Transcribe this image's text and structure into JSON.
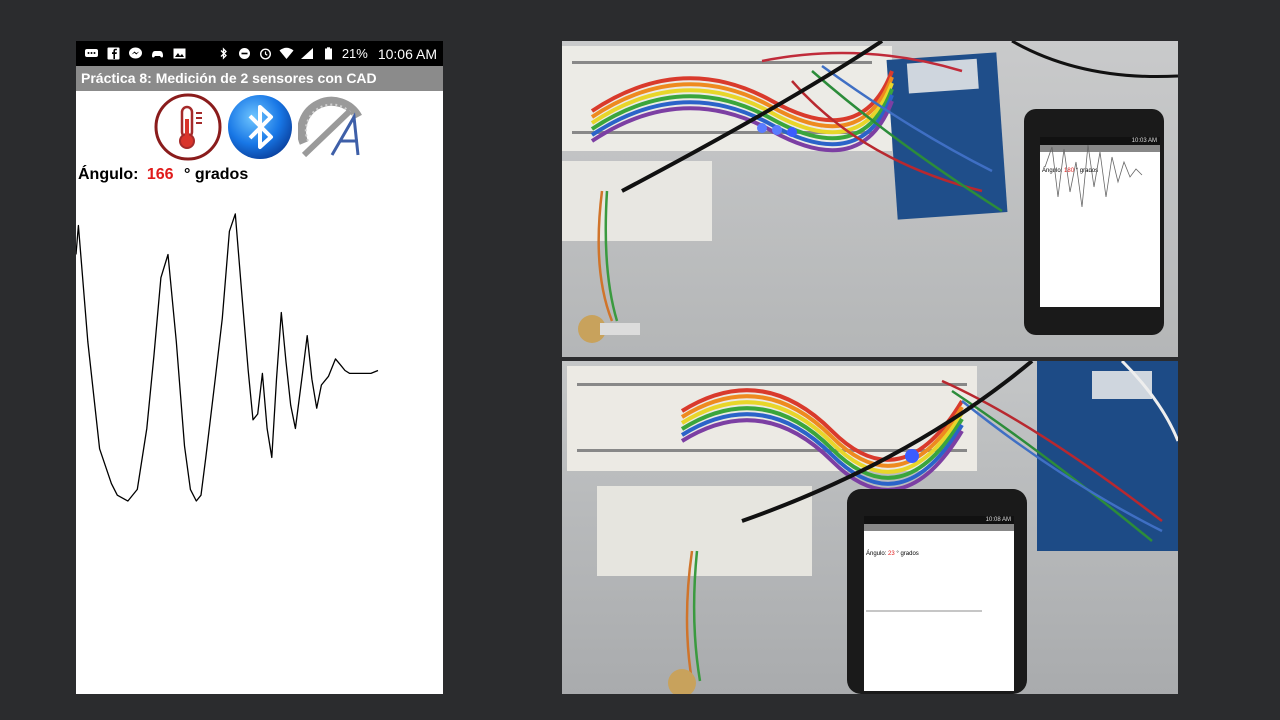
{
  "status_bar": {
    "battery": "21%",
    "time": "10:06 AM",
    "left_icons": [
      "chat-icon",
      "facebook-icon",
      "messenger-icon",
      "gamepad-icon",
      "photo-icon"
    ],
    "right_icons": [
      "bluetooth-icon",
      "dnd-icon",
      "alarm-icon",
      "wifi-icon",
      "signal-icon",
      "battery-icon"
    ]
  },
  "app": {
    "title": "Práctica 8: Medición de 2 sensores con CAD",
    "icons": [
      "thermometer-icon",
      "bluetooth-icon",
      "protractor-icon"
    ],
    "angle_label": "Ángulo:",
    "angle_value": "166",
    "angle_unit": "° grados"
  },
  "chart_data": {
    "type": "line",
    "title": "",
    "xlabel": "",
    "ylabel": "",
    "grid": false,
    "points": [
      [
        0,
        0.85
      ],
      [
        2,
        0.95
      ],
      [
        10,
        0.55
      ],
      [
        20,
        0.18
      ],
      [
        30,
        0.06
      ],
      [
        35,
        0.02
      ],
      [
        44,
        0.0
      ],
      [
        52,
        0.04
      ],
      [
        60,
        0.25
      ],
      [
        66,
        0.5
      ],
      [
        72,
        0.77
      ],
      [
        78,
        0.85
      ],
      [
        85,
        0.55
      ],
      [
        92,
        0.19
      ],
      [
        97,
        0.04
      ],
      [
        102,
        0.0
      ],
      [
        106,
        0.02
      ],
      [
        110,
        0.15
      ],
      [
        118,
        0.42
      ],
      [
        124,
        0.63
      ],
      [
        130,
        0.93
      ],
      [
        135,
        0.99
      ],
      [
        140,
        0.74
      ],
      [
        146,
        0.45
      ],
      [
        150,
        0.28
      ],
      [
        154,
        0.3
      ],
      [
        158,
        0.44
      ],
      [
        162,
        0.25
      ],
      [
        166,
        0.15
      ],
      [
        170,
        0.42
      ],
      [
        174,
        0.65
      ],
      [
        178,
        0.48
      ],
      [
        182,
        0.33
      ],
      [
        186,
        0.25
      ],
      [
        192,
        0.44
      ],
      [
        196,
        0.57
      ],
      [
        200,
        0.42
      ],
      [
        204,
        0.32
      ],
      [
        208,
        0.4
      ],
      [
        214,
        0.43
      ],
      [
        220,
        0.49
      ],
      [
        224,
        0.47
      ],
      [
        228,
        0.45
      ],
      [
        232,
        0.44
      ],
      [
        238,
        0.44
      ],
      [
        244,
        0.44
      ],
      [
        250,
        0.44
      ],
      [
        256,
        0.45
      ]
    ]
  },
  "photos": {
    "top_phone_angle_label": "Ángulo:",
    "top_phone_angle_value": "180",
    "top_phone_angle_unit": "° grados",
    "top_phone_time": "10:03 AM",
    "bottom_phone_angle_label": "Ángulo:",
    "bottom_phone_angle_value": "23",
    "bottom_phone_angle_unit": "° grados",
    "bottom_phone_time": "10:08 AM"
  }
}
